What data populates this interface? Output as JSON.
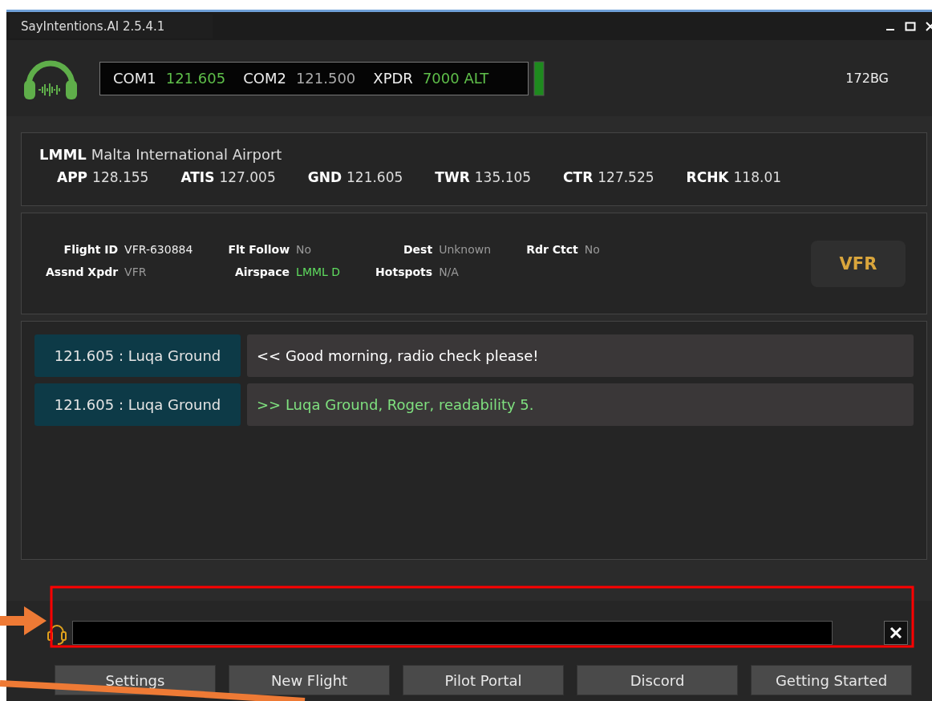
{
  "window": {
    "title": "SayIntentions.AI  2.5.4.1"
  },
  "radio": {
    "fields": [
      {
        "label": "COM1",
        "value": "121.605",
        "active": true
      },
      {
        "label": "COM2",
        "value": "121.500",
        "active": false
      },
      {
        "label": "XPDR",
        "value": "7000 ALT",
        "active": true
      }
    ],
    "callsign": "172BG"
  },
  "airport": {
    "code": "LMML",
    "name": "Malta International Airport",
    "frequencies": [
      {
        "label": "APP",
        "value": "128.155"
      },
      {
        "label": "ATIS",
        "value": "127.005"
      },
      {
        "label": "GND",
        "value": "121.605"
      },
      {
        "label": "TWR",
        "value": "135.105"
      },
      {
        "label": "CTR",
        "value": "127.525"
      },
      {
        "label": "RCHK",
        "value": "118.01"
      }
    ]
  },
  "flight": {
    "columns": [
      [
        {
          "label": "Flight ID",
          "value": "VFR-630884",
          "kind": "bright"
        },
        {
          "label": "Assnd Xpdr",
          "value": "VFR",
          "kind": "dim"
        }
      ],
      [
        {
          "label": "Flt Follow",
          "value": "No",
          "kind": "dim"
        },
        {
          "label": "Airspace",
          "value": "LMML D",
          "kind": "green"
        }
      ],
      [
        {
          "label": "Dest",
          "value": "Unknown",
          "kind": "dim"
        },
        {
          "label": "Hotspots",
          "value": "N/A",
          "kind": "dim"
        }
      ],
      [
        {
          "label": "Rdr Ctct",
          "value": "No",
          "kind": "dim"
        }
      ]
    ],
    "rules": "VFR"
  },
  "messages": [
    {
      "station": "121.605 : Luqa Ground",
      "text": "<< Good morning, radio check please!",
      "kind": "sent"
    },
    {
      "station": "121.605 : Luqa Ground",
      "text": ">> Luqa Ground, Roger, readability 5.",
      "kind": "received"
    }
  ],
  "buttons": [
    "Settings",
    "New Flight",
    "Pilot Portal",
    "Discord",
    "Getting Started"
  ]
}
